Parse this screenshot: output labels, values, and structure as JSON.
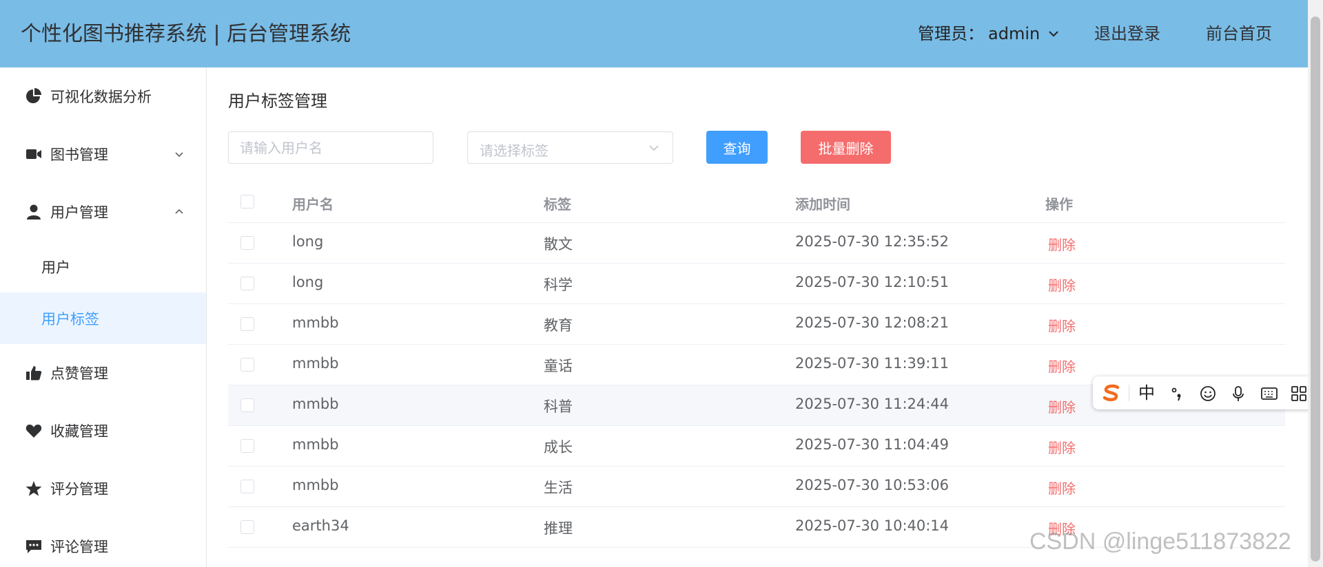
{
  "header": {
    "title": "个性化图书推荐系统 | 后台管理系统",
    "admin_label": "管理员：",
    "admin_name": "admin",
    "logout": "退出登录",
    "frontend_home": "前台首页",
    "background_color": "#79bce6"
  },
  "sidebar": {
    "items": [
      {
        "label": "可视化数据分析",
        "icon": "pie-chart-icon"
      },
      {
        "label": "图书管理",
        "icon": "video-camera-icon",
        "arrow": "chevron-down-icon"
      },
      {
        "label": "用户管理",
        "icon": "user-icon",
        "arrow": "chevron-up-icon"
      },
      {
        "label": "点赞管理",
        "icon": "thumbs-up-icon"
      },
      {
        "label": "收藏管理",
        "icon": "heart-icon"
      },
      {
        "label": "评分管理",
        "icon": "star-icon"
      },
      {
        "label": "评论管理",
        "icon": "comment-icon"
      }
    ],
    "submenu": [
      {
        "label": "用户",
        "active": false
      },
      {
        "label": "用户标签",
        "active": true
      }
    ],
    "active_color": "#409eff",
    "active_background": "#ecf5ff"
  },
  "main": {
    "page_title": "用户标签管理",
    "filters": {
      "username_placeholder": "请输入用户名",
      "tag_placeholder": "请选择标签",
      "query_button": "查询",
      "batch_delete_button": "批量删除"
    },
    "table": {
      "headers": [
        "用户名",
        "标签",
        "添加时间",
        "操作"
      ],
      "rows": [
        {
          "username": "long",
          "tag": "散文",
          "time": "2025-07-30 12:35:52",
          "action": "删除"
        },
        {
          "username": "long",
          "tag": "科学",
          "time": "2025-07-30 12:10:51",
          "action": "删除"
        },
        {
          "username": "mmbb",
          "tag": "教育",
          "time": "2025-07-30 12:08:21",
          "action": "删除"
        },
        {
          "username": "mmbb",
          "tag": "童话",
          "time": "2025-07-30 11:39:11",
          "action": "删除"
        },
        {
          "username": "mmbb",
          "tag": "科普",
          "time": "2025-07-30 11:24:44",
          "action": "删除"
        },
        {
          "username": "mmbb",
          "tag": "成长",
          "time": "2025-07-30 11:04:49",
          "action": "删除"
        },
        {
          "username": "mmbb",
          "tag": "生活",
          "time": "2025-07-30 10:53:06",
          "action": "删除"
        },
        {
          "username": "earth34",
          "tag": "推理",
          "time": "2025-07-30 10:40:14",
          "action": "删除"
        }
      ]
    }
  },
  "ime_toolbar": {
    "mode": "中",
    "icons": [
      "sogou-logo-icon",
      "punctuation-icon",
      "emoji-icon",
      "microphone-icon",
      "keyboard-icon",
      "grid-menu-icon"
    ]
  },
  "watermark": "CSDN @linge511873822",
  "colors": {
    "primary": "#409eff",
    "danger": "#f56c6c"
  }
}
